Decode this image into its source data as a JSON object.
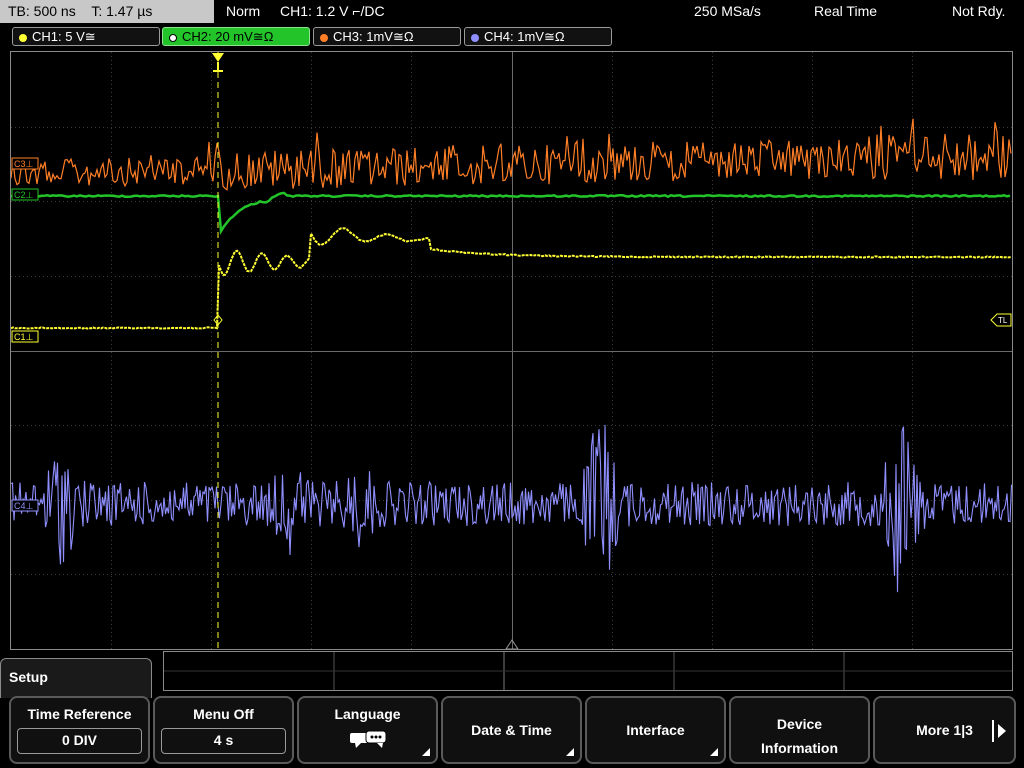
{
  "status": {
    "timebase": "TB: 500 ns",
    "trigger_time": "T: 1.47 µs",
    "mode": "Norm",
    "trigger": "CH1: 1.2 V ⌐/DC",
    "sample_rate": "250 MSa/s",
    "acq_mode": "Real Time",
    "state": "Not Rdy."
  },
  "channels": [
    {
      "label": "CH1: 5 V≅",
      "color": "#ffff33",
      "active": false
    },
    {
      "label": "CH2: 20 mV≅Ω",
      "color": "#22c42a",
      "active": true
    },
    {
      "label": "CH3: 1mV≅Ω",
      "color": "#ff7f27",
      "active": false
    },
    {
      "label": "CH4: 1mV≅Ω",
      "color": "#8f8fff",
      "active": false
    }
  ],
  "markers": {
    "c3": "C3⊥",
    "c2": "C2⊥",
    "c1": "C1⊥",
    "c4": "C4⊥",
    "tl": "TL"
  },
  "menu": {
    "title": "Setup",
    "keys": [
      {
        "label": "Time Reference",
        "value": "0 DIV"
      },
      {
        "label": "Menu Off",
        "value": "4 s"
      },
      {
        "label": "Language"
      },
      {
        "label": "Date & Time"
      },
      {
        "label": "Interface"
      },
      {
        "label": "Device Information"
      },
      {
        "label": "More 1|3"
      }
    ]
  }
}
